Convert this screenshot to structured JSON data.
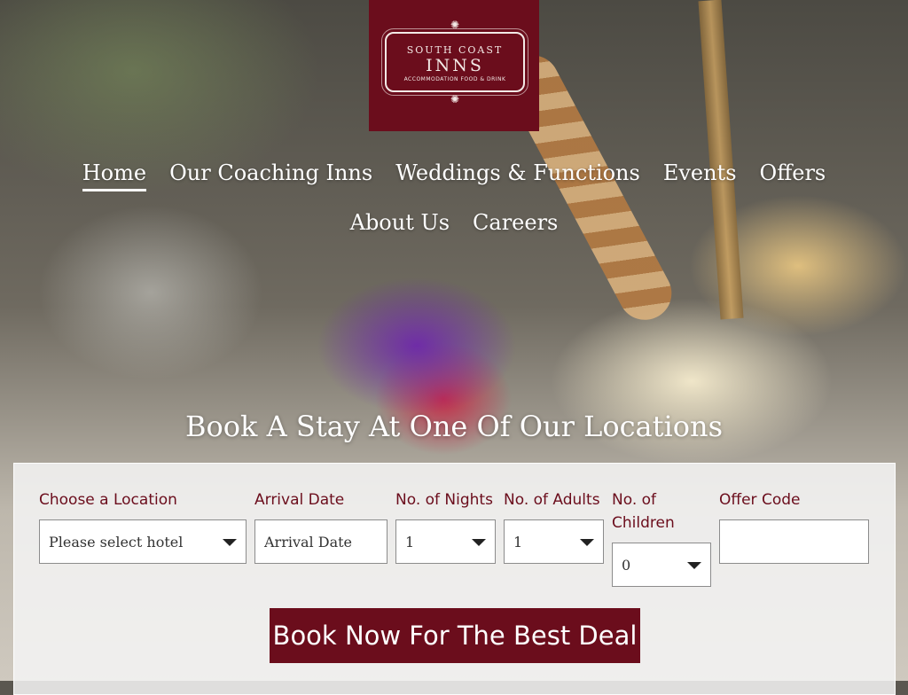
{
  "brand": {
    "top": "SOUTH COAST",
    "main": "INNS",
    "tagline": "ACCOMMODATION FOOD & DRINK",
    "color": "#6b0d1c"
  },
  "nav": {
    "items": [
      {
        "label": "Home",
        "active": true
      },
      {
        "label": "Our Coaching Inns"
      },
      {
        "label": "Weddings & Functions"
      },
      {
        "label": "Events"
      },
      {
        "label": "Offers"
      },
      {
        "label": "About Us"
      },
      {
        "label": "Careers"
      }
    ]
  },
  "hero": {
    "title": "Book A Stay At One Of Our Locations"
  },
  "booking": {
    "location": {
      "label": "Choose a Location",
      "value": "Please select hotel"
    },
    "arrival": {
      "label": "Arrival Date",
      "placeholder": "Arrival Date"
    },
    "nights": {
      "label": "No. of Nights",
      "value": "1"
    },
    "adults": {
      "label": "No. of Adults",
      "value": "1"
    },
    "children": {
      "label": "No. of Children",
      "value": "0"
    },
    "offer": {
      "label": "Offer Code",
      "value": ""
    },
    "submit_label": "Book Now For The Best Deal"
  }
}
